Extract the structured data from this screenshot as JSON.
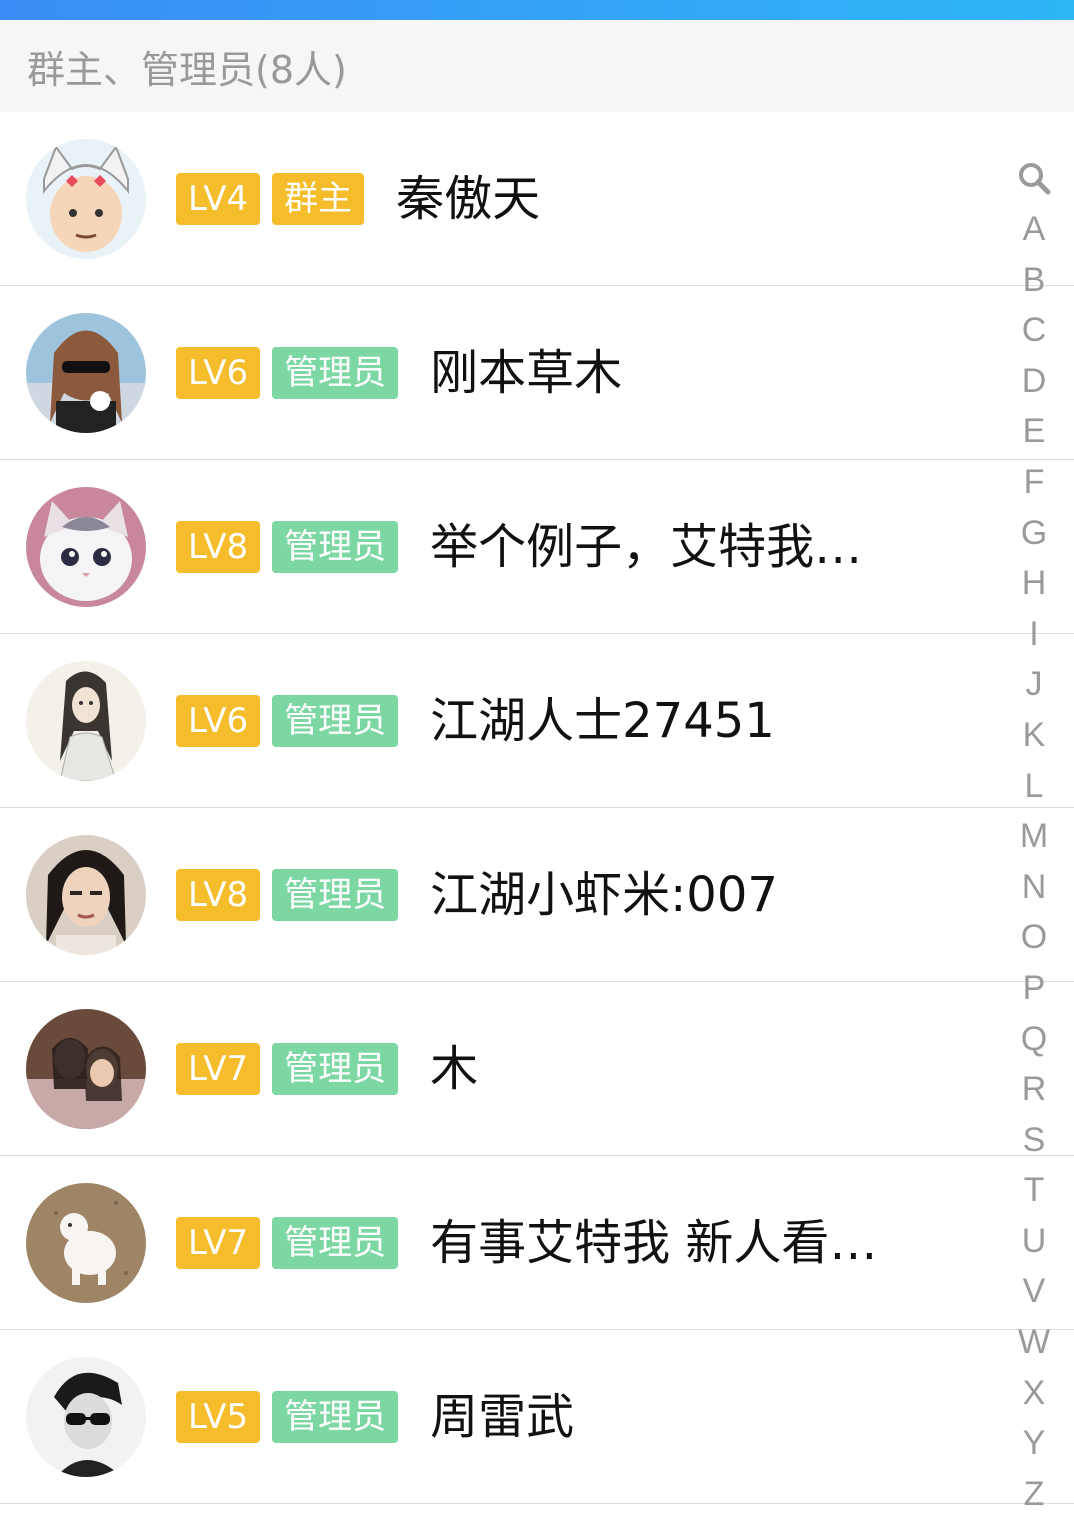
{
  "section": {
    "title": "群主、管理员(8人)"
  },
  "members": [
    {
      "level": "LV4",
      "role": "群主",
      "role_type": "owner",
      "name": "秦傲天",
      "avatar": "cartoon-cat-hat-avatar"
    },
    {
      "level": "LV6",
      "role": "管理员",
      "role_type": "admin",
      "name": "刚本草木",
      "avatar": "woman-sunglasses-avatar"
    },
    {
      "level": "LV8",
      "role": "管理员",
      "role_type": "admin",
      "name": "举个例子，艾特我…",
      "avatar": "kitten-avatar"
    },
    {
      "level": "LV6",
      "role": "管理员",
      "role_type": "admin",
      "name": "江湖人士27451",
      "avatar": "ink-swordsman-avatar"
    },
    {
      "level": "LV8",
      "role": "管理员",
      "role_type": "admin",
      "name": "江湖小虾米:007",
      "avatar": "costume-man-avatar"
    },
    {
      "level": "LV7",
      "role": "管理员",
      "role_type": "admin",
      "name": "木",
      "avatar": "couple-photo-avatar"
    },
    {
      "level": "LV7",
      "role": "管理员",
      "role_type": "admin",
      "name": "有事艾特我 新人看…",
      "avatar": "white-puppy-avatar"
    },
    {
      "level": "LV5",
      "role": "管理员",
      "role_type": "admin",
      "name": "周雷武",
      "avatar": "bw-man-sunglasses-avatar"
    }
  ],
  "index_bar": {
    "search_icon": "search-icon",
    "letters": [
      "A",
      "B",
      "C",
      "D",
      "E",
      "F",
      "G",
      "H",
      "I",
      "J",
      "K",
      "L",
      "M",
      "N",
      "O",
      "P",
      "Q",
      "R",
      "S",
      "T",
      "U",
      "V",
      "W",
      "X",
      "Y",
      "Z"
    ]
  },
  "colors": {
    "accent_gradient_start": "#3a8df6",
    "accent_gradient_end": "#2eb6f6",
    "level_badge": "#f5bd2b",
    "admin_badge": "#7dd7a3",
    "owner_badge": "#f5bd2b"
  }
}
